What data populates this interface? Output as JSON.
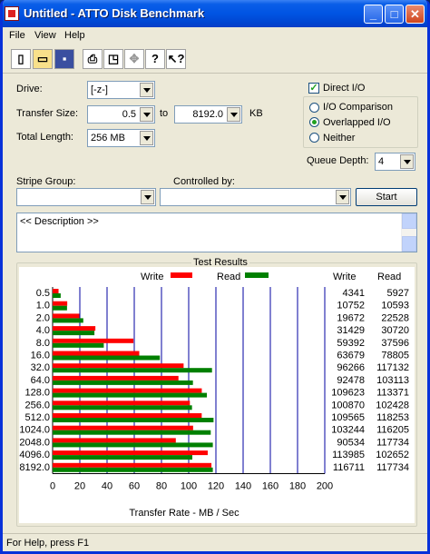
{
  "window": {
    "title": "Untitled - ATTO Disk Benchmark"
  },
  "menu": [
    {
      "label": "File"
    },
    {
      "label": "View"
    },
    {
      "label": "Help"
    }
  ],
  "form": {
    "drive_label": "Drive:",
    "drive_value": "[-z-]",
    "transfer_size_label": "Transfer Size:",
    "transfer_from": "0.5",
    "to_label": "to",
    "transfer_to": "8192.0",
    "kb_label": "KB",
    "total_length_label": "Total Length:",
    "total_length_value": "256 MB",
    "direct_io_label": "Direct I/O",
    "io_comparison_label": "I/O Comparison",
    "overlapped_io_label": "Overlapped I/O",
    "neither_label": "Neither",
    "queue_depth_label": "Queue Depth:",
    "queue_depth_value": "4",
    "stripe_group_label": "Stripe Group:",
    "controlled_by_label": "Controlled by:",
    "start_label": "Start",
    "description": "<< Description >>"
  },
  "results": {
    "title": "Test Results",
    "write_legend": "Write",
    "read_legend": "Read",
    "write_col": "Write",
    "read_col": "Read",
    "colors": {
      "write": "#ff0000",
      "read": "#008000",
      "grid": "#0000a0"
    }
  },
  "chart_data": {
    "type": "bar",
    "orientation": "horizontal",
    "categories": [
      "0.5",
      "1.0",
      "2.0",
      "4.0",
      "8.0",
      "16.0",
      "32.0",
      "64.0",
      "128.0",
      "256.0",
      "512.0",
      "1024.0",
      "2048.0",
      "4096.0",
      "8192.0"
    ],
    "series": [
      {
        "name": "Write",
        "values": [
          4341,
          10752,
          19672,
          31429,
          59392,
          63679,
          96266,
          92478,
          109623,
          100870,
          109565,
          103244,
          90534,
          113985,
          116711
        ]
      },
      {
        "name": "Read",
        "values": [
          5927,
          10593,
          22528,
          30720,
          37596,
          78805,
          117132,
          103113,
          113371,
          102428,
          118253,
          116205,
          117734,
          102652,
          117734
        ]
      }
    ],
    "xlabel": "Transfer Rate - MB / Sec",
    "xlim": [
      0,
      200
    ],
    "xticks": [
      0,
      20,
      40,
      60,
      80,
      100,
      120,
      140,
      160,
      180,
      200
    ],
    "value_scale": 1000,
    "grid": true
  },
  "status": {
    "text": "For Help, press F1"
  }
}
